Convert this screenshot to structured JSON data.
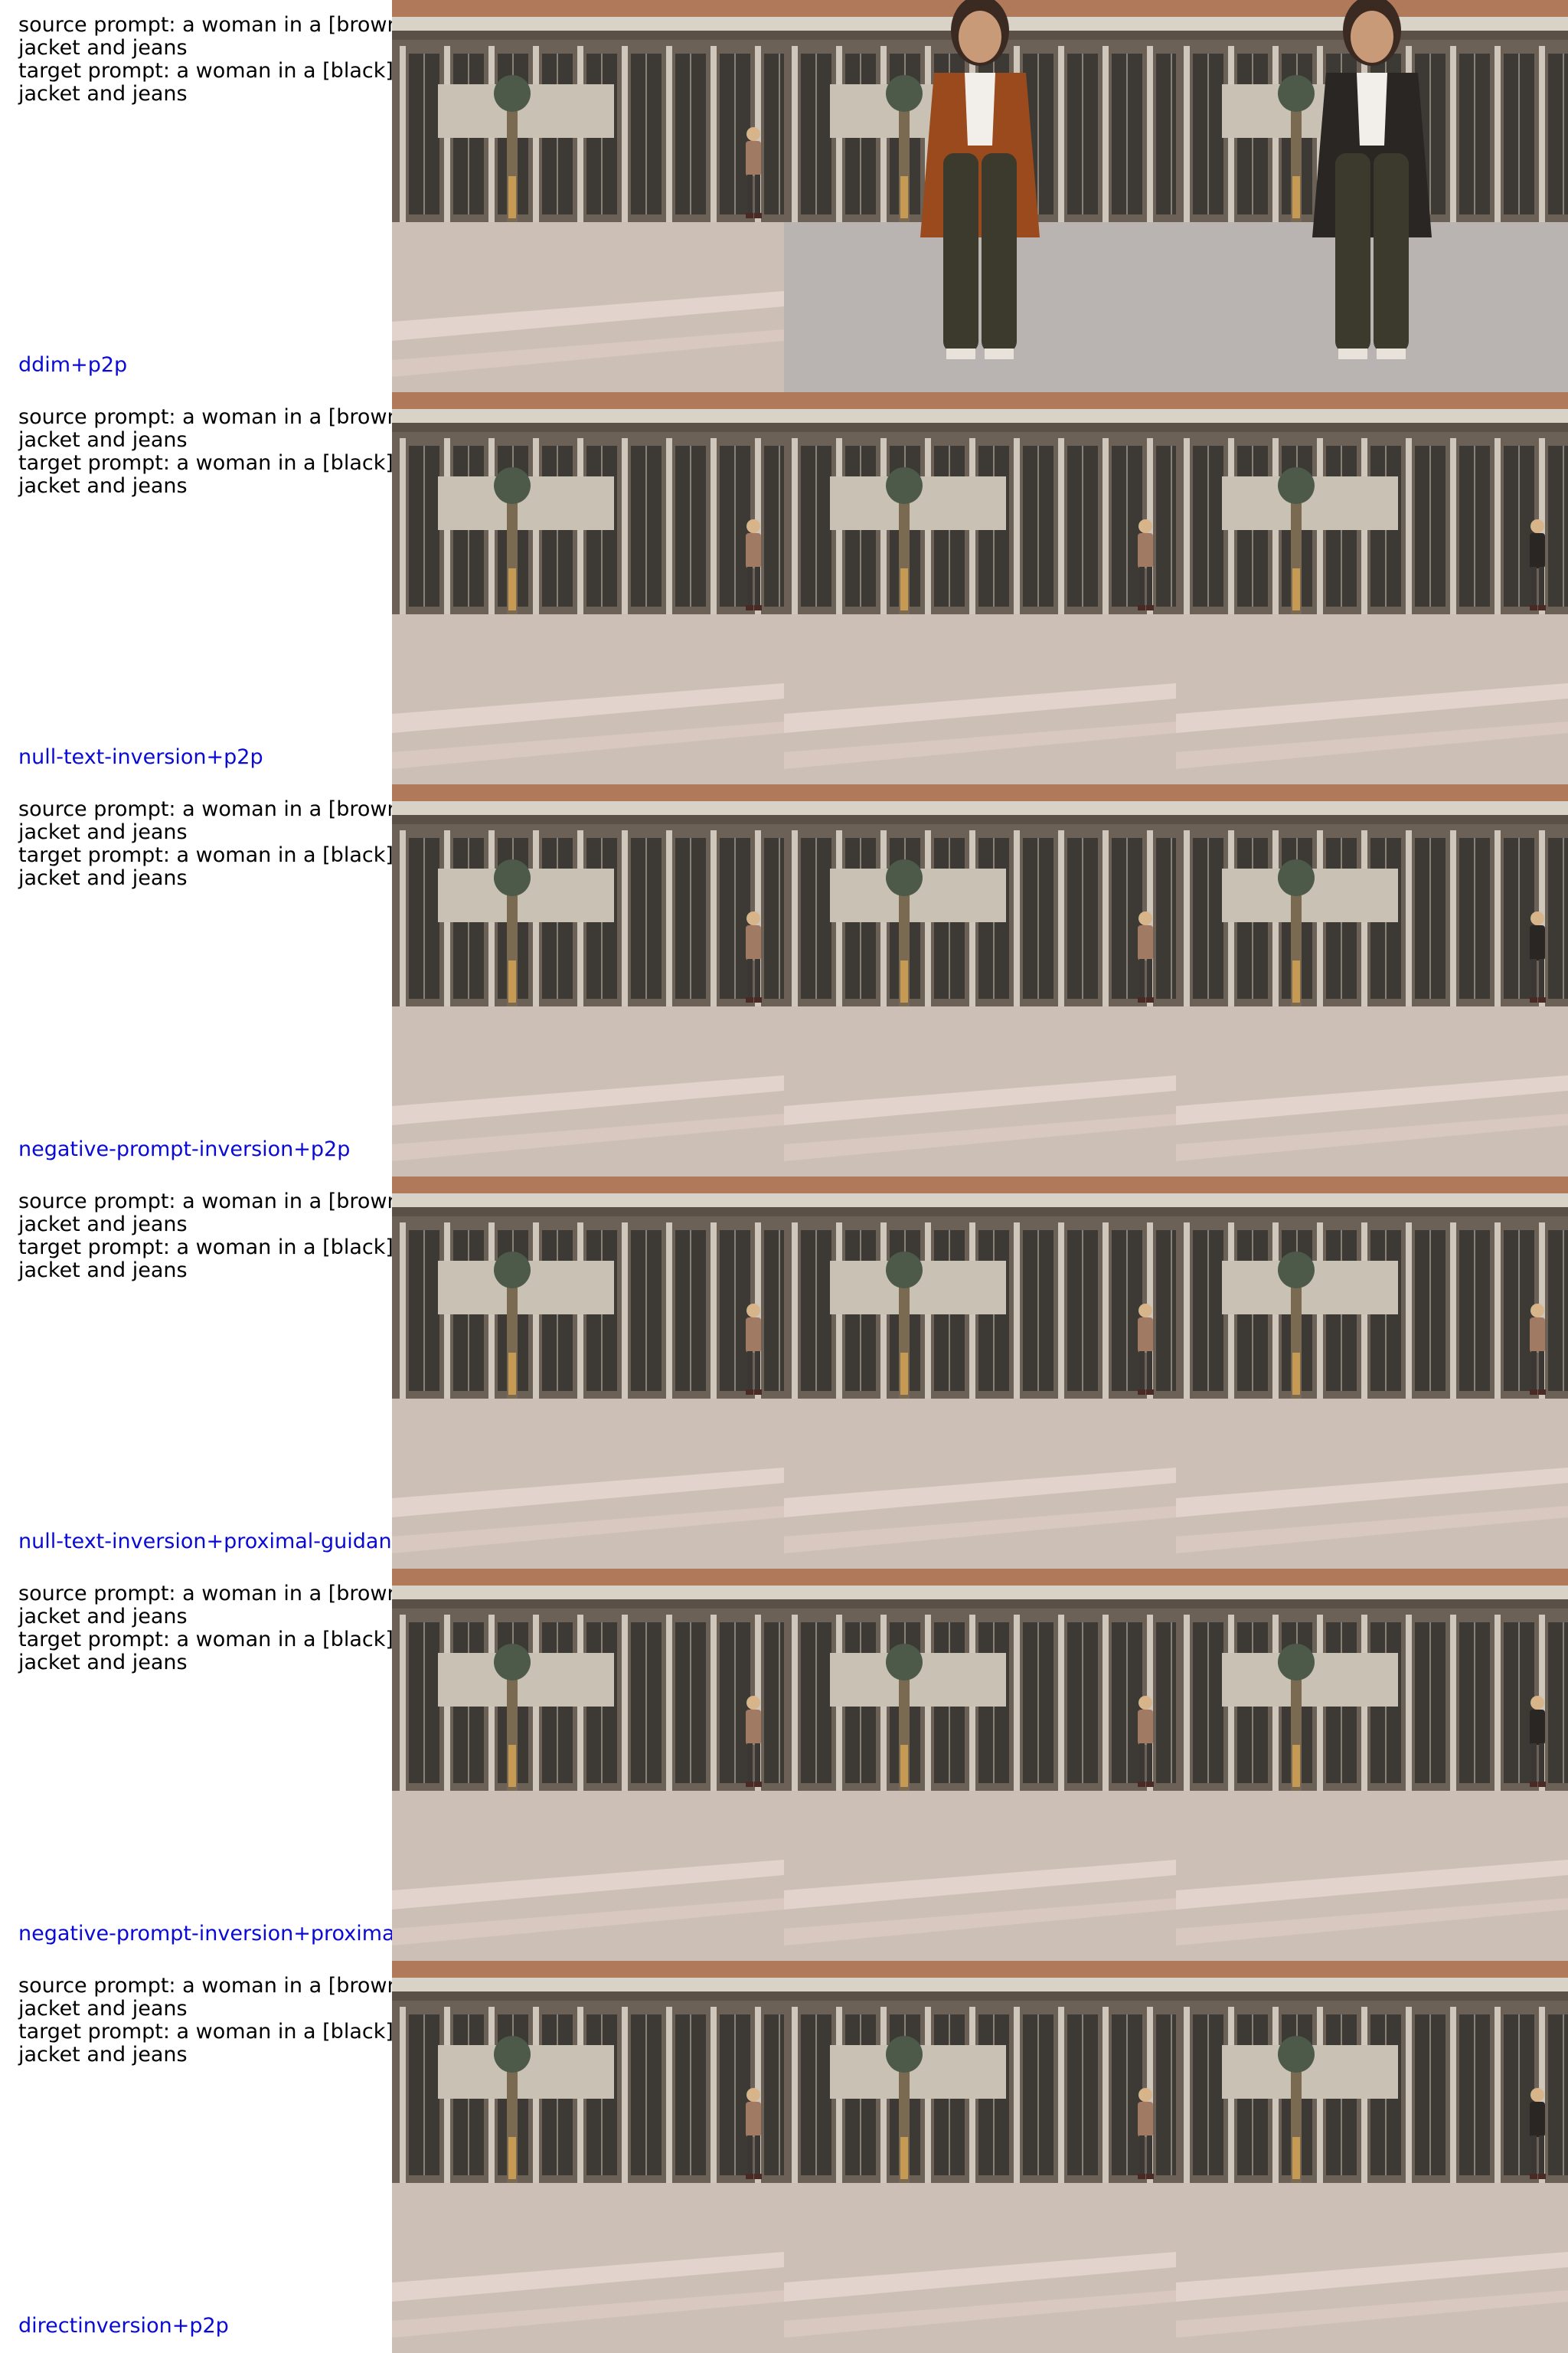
{
  "rows": [
    {
      "prompt": {
        "source_line1": "source prompt: a woman in a [brown]",
        "source_line2": "jacket and jeans",
        "target_line1": "target prompt: a woman in a [black]",
        "target_line2": "jacket and jeans"
      },
      "method": "ddim+p2p",
      "images": [
        "source photo: woman standing in a plaza",
        "reconstruction: woman in brown jacket",
        "edit: woman in black jacket"
      ]
    },
    {
      "prompt": {
        "source_line1": "source prompt: a woman in a [brown]",
        "source_line2": "jacket and jeans",
        "target_line1": "target prompt: a woman in a [black]",
        "target_line2": "jacket and jeans"
      },
      "method": "null-text-inversion+p2p",
      "images": [
        "source photo",
        "reconstruction",
        "edit"
      ]
    },
    {
      "prompt": {
        "source_line1": "source prompt: a woman in a [brown]",
        "source_line2": "jacket and jeans",
        "target_line1": "target prompt: a woman in a [black]",
        "target_line2": "jacket and jeans"
      },
      "method": "negative-prompt-inversion+p2p",
      "images": [
        "source photo",
        "reconstruction",
        "edit"
      ]
    },
    {
      "prompt": {
        "source_line1": "source prompt: a woman in a [brown]",
        "source_line2": "jacket and jeans",
        "target_line1": "target prompt: a woman in a [black]",
        "target_line2": "jacket and jeans"
      },
      "method": "null-text-inversion+proximal-guidance",
      "images": [
        "source photo",
        "reconstruction",
        "edit"
      ]
    },
    {
      "prompt": {
        "source_line1": "source prompt: a woman in a [brown]",
        "source_line2": "jacket and jeans",
        "target_line1": "target prompt: a woman in a [black]",
        "target_line2": "jacket and jeans"
      },
      "method": "negative-prompt-inversion+proximal-g",
      "images": [
        "source photo",
        "reconstruction",
        "edit"
      ]
    },
    {
      "prompt": {
        "source_line1": "source prompt: a woman in a [brown]",
        "source_line2": "jacket and jeans",
        "target_line1": "target prompt: a woman in a [black]",
        "target_line2": "jacket and jeans"
      },
      "method": "directinversion+p2p",
      "images": [
        "source photo",
        "reconstruction",
        "edit"
      ]
    }
  ],
  "colors": {
    "caption_text": "#000000",
    "method_label": "#0a0ad6",
    "background": "#ffffff"
  }
}
